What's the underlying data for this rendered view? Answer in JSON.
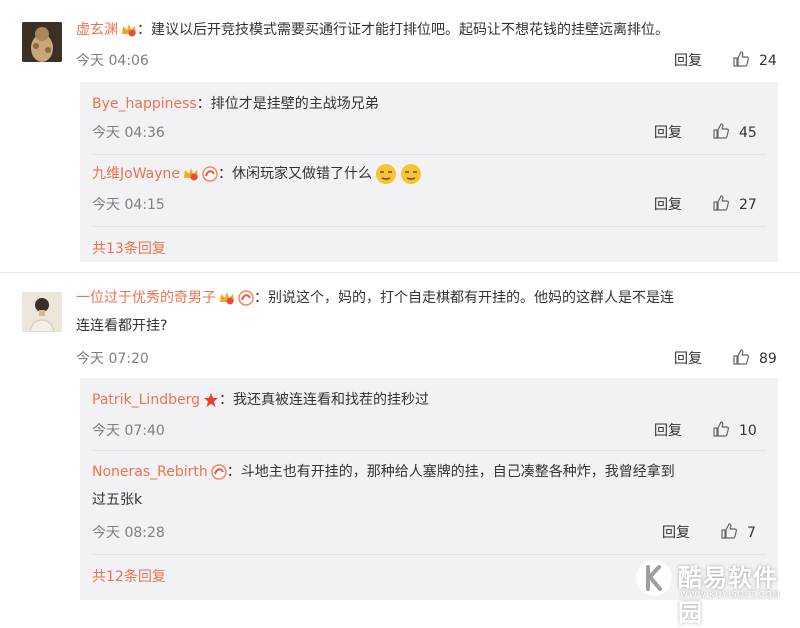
{
  "comments": [
    {
      "author": "虚玄渊",
      "text": "：建议以后开竞技模式需要买通行证才能打排位吧。起码让不想花钱的挂壁远离排位。",
      "time": "今天 04:06",
      "reply_label": "回复",
      "likes": "24",
      "replies": [
        {
          "author": "Bye_happiness",
          "text": "：排位才是挂壁的主战场兄弟",
          "time": "今天 04:36",
          "reply_label": "回复",
          "likes": "45"
        },
        {
          "author": "九维JoWayne",
          "text": "：休闲玩家又做错了什么",
          "time": "今天 04:15",
          "reply_label": "回复",
          "likes": "27"
        }
      ],
      "more_label": "共13条回复"
    },
    {
      "author": "一位过于优秀的奇男子",
      "text_line1": "：别说这个，妈的，打个自走棋都有开挂的。他妈的这群人是不是连",
      "text_line2": "连连看都开挂?",
      "time": "今天 07:20",
      "reply_label": "回复",
      "likes": "89",
      "replies": [
        {
          "author": "Patrik_Lindberg",
          "text": "：我还真被连连看和找茬的挂秒过",
          "time": "今天 07:40",
          "reply_label": "回复",
          "likes": "10"
        },
        {
          "author": "Noneras_Rebirth",
          "text_line1": "：斗地主也有开挂的，那种给人塞牌的挂，自己凑整各种炸，我曾经拿到",
          "text_line2": "过五张k",
          "time": "今天 08:28",
          "reply_label": "回复",
          "likes": "7"
        }
      ],
      "more_label": "共12条回复"
    }
  ],
  "colors": {
    "author": "#eb7350",
    "subbg": "#f2f2f5",
    "time": "#808080"
  },
  "watermark": {
    "text": "酷易软件园",
    "url": "WWW.KUYISOFT.COM"
  }
}
